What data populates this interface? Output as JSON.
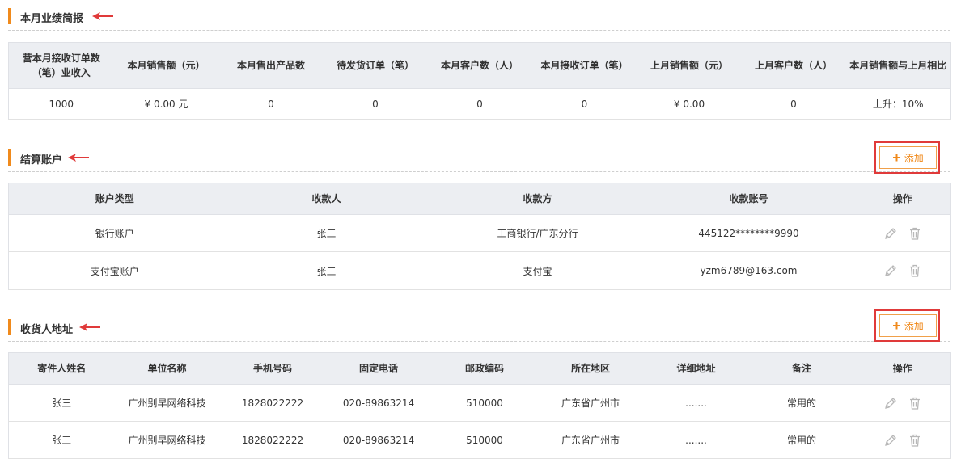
{
  "performance": {
    "title": "本月业绩简报",
    "headers": [
      "营本月接收订单数（笔）业收入",
      "本月销售额（元）",
      "本月售出产品数",
      "待发货订单（笔）",
      "本月客户数（人）",
      "本月接收订单（笔）",
      "上月销售额（元）",
      "上月客户数（人）",
      "本月销售额与上月相比"
    ],
    "row": [
      "1000",
      "¥ 0.00 元",
      "0",
      "0",
      "0",
      "0",
      "¥ 0.00",
      "0",
      "上升：10%"
    ]
  },
  "accounts": {
    "title": "结算账户",
    "add_label": "添加",
    "headers": [
      "账户类型",
      "收款人",
      "收款方",
      "收款账号",
      "操作"
    ],
    "rows": [
      [
        "银行账户",
        "张三",
        "工商银行/广东分行",
        "445122********9990"
      ],
      [
        "支付宝账户",
        "张三",
        "支付宝",
        "yzm6789@163.com"
      ]
    ]
  },
  "addresses": {
    "title": "收货人地址",
    "add_label": "添加",
    "headers": [
      "寄件人姓名",
      "单位名称",
      "手机号码",
      "固定电话",
      "邮政编码",
      "所在地区",
      "详细地址",
      "备注",
      "操作"
    ],
    "rows": [
      [
        "张三",
        "广州别早网络科技",
        "1828022222",
        "020-89863214",
        "510000",
        "广东省广州市",
        ".......",
        "常用的"
      ],
      [
        "张三",
        "广州别早网络科技",
        "1828022222",
        "020-89863214",
        "510000",
        "广东省广州市",
        ".......",
        "常用的"
      ]
    ]
  },
  "colors": {
    "accent": "#f08a1c",
    "highlight": "#e03a3a",
    "header_bg": "#eceef2"
  },
  "icons": {
    "edit": "pencil-icon",
    "delete": "trash-icon",
    "add": "plus-icon",
    "pointer": "red-arrow-icon"
  }
}
